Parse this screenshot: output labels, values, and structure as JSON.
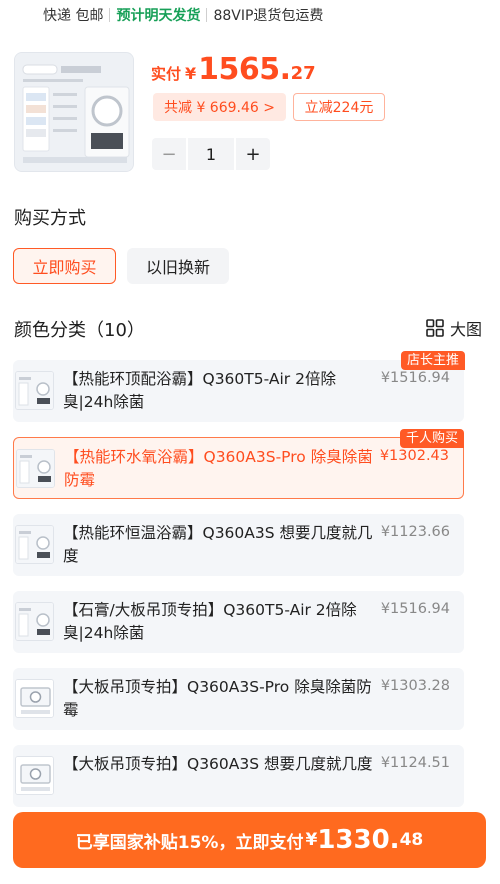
{
  "topbar": {
    "shipping": "快递 包邮",
    "dispatch": "预计明天发货",
    "vip": "88VIP退货包运费"
  },
  "product": {
    "paid_label": "实付",
    "currency": "¥",
    "price_int": "1565.",
    "price_dec": "27",
    "total_discount": "共减 ¥ 669.46 >",
    "instant_discount": "立减224元",
    "quantity": "1",
    "minus": "−",
    "plus": "+"
  },
  "purchase": {
    "title": "购买方式",
    "options": [
      "立即购买",
      "以旧换新"
    ]
  },
  "colors": {
    "title": "颜色分类（10）",
    "big_view": "大图",
    "items": [
      {
        "text": "【热能环顶配浴霸】Q360T5-Air 2倍除臭|24h除菌",
        "price": "¥1516.94",
        "tag": "店长主推"
      },
      {
        "text": "【热能环水氧浴霸】Q360A3S-Pro 除臭除菌防霉",
        "price": "¥1302.43",
        "tag": "千人购买"
      },
      {
        "text": "【热能环恒温浴霸】Q360A3S 想要几度就几度",
        "price": "¥1123.66",
        "tag": ""
      },
      {
        "text": "【石膏/大板吊顶专拍】Q360T5-Air 2倍除臭|24h除菌",
        "price": "¥1516.94",
        "tag": ""
      },
      {
        "text": "【大板吊顶专拍】Q360A3S-Pro 除臭除菌防霉",
        "price": "¥1303.28",
        "tag": ""
      },
      {
        "text": "【大板吊顶专拍】Q360A3S 想要几度就几度",
        "price": "¥1124.51",
        "tag": ""
      }
    ]
  },
  "paybar": {
    "label": "已享国家补贴15%，立即支付",
    "currency": "¥",
    "int": "1330.",
    "dec": "48"
  },
  "colors_palette": {
    "accent": "#ff5a26",
    "green": "#18a058",
    "pay": "#ff6a1f"
  }
}
